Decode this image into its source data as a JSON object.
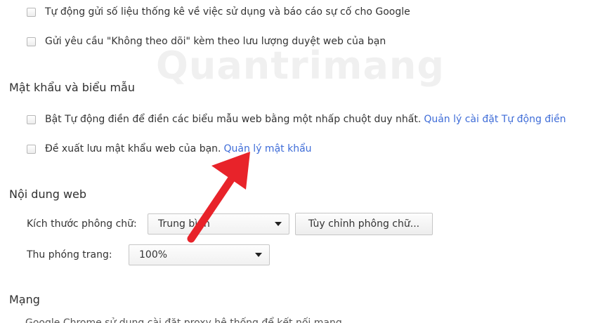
{
  "privacy": {
    "items": [
      {
        "label": "Tự động gửi số liệu thống kê về việc sử dụng và báo cáo sự cố cho Google"
      },
      {
        "label": "Gửi yêu cầu \"Không theo dõi\" kèm theo lưu lượng duyệt web của bạn"
      }
    ]
  },
  "watermark": {
    "text": "Quantrimang"
  },
  "passwords": {
    "title": "Mật khẩu và biểu mẫu",
    "autofill_label": "Bật Tự động điền để điền các biểu mẫu web bằng một nhấp chuột duy nhất.",
    "autofill_link": "Quản lý cài đặt Tự động điền",
    "save_passwords_label": "Đề xuất lưu mật khẩu web của bạn.",
    "manage_passwords_link": "Quản lý mật khẩu"
  },
  "web_content": {
    "title": "Nội dung web",
    "font_size_label": "Kích thước phông chữ:",
    "font_size_value": "Trung bình",
    "customize_fonts_button": "Tùy chỉnh phông chữ...",
    "page_zoom_label": "Thu phóng trang:",
    "page_zoom_value": "100%"
  },
  "network": {
    "title": "Mạng",
    "description": "Google Chrome sử dụng cài đặt proxy hệ thống để kết nối mạng"
  },
  "annotation": {
    "arrow_color": "#e8232a"
  }
}
